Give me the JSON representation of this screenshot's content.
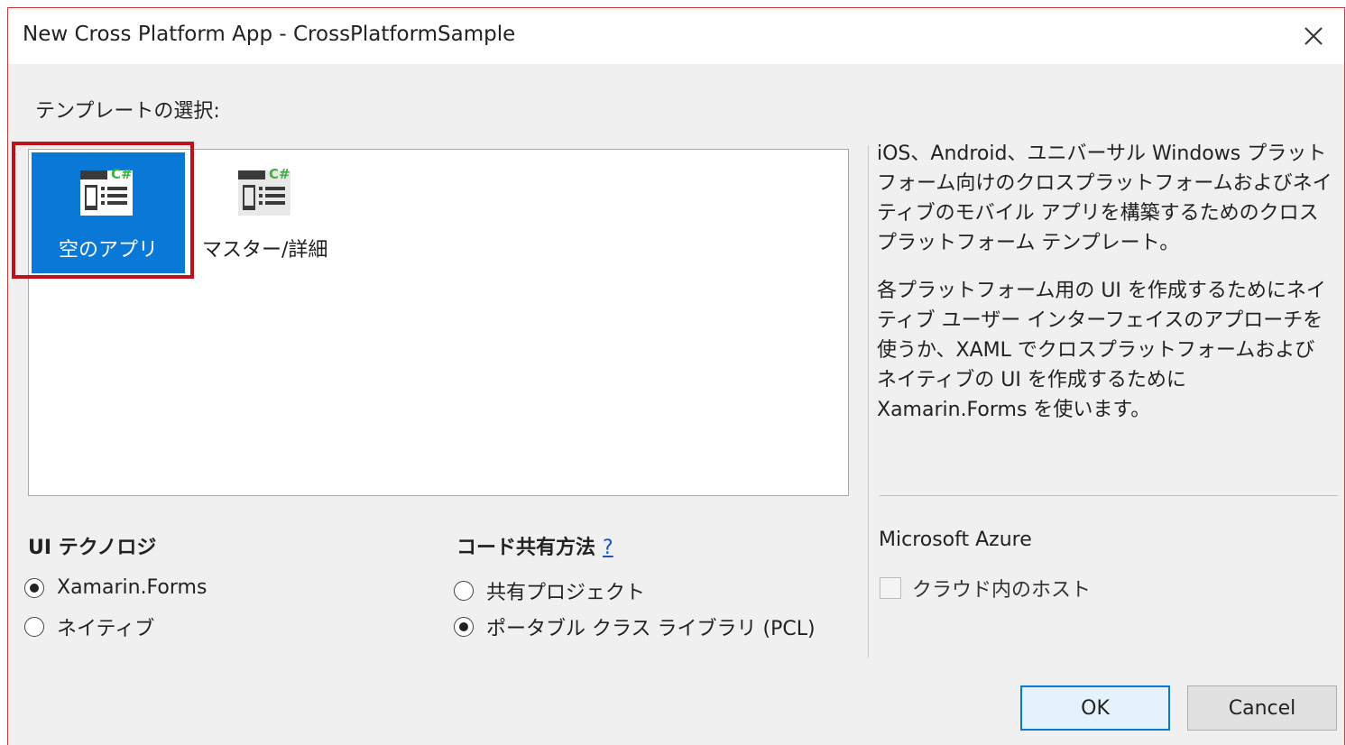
{
  "window": {
    "title": "New Cross Platform App - CrossPlatformSample"
  },
  "templates": {
    "label": "テンプレートの選択:",
    "items": [
      {
        "name": "空のアプリ",
        "selected": true,
        "icon": "blank-app-csharp-icon"
      },
      {
        "name": "マスター/詳細",
        "selected": false,
        "icon": "master-detail-csharp-icon"
      }
    ]
  },
  "description": {
    "p1": "iOS、Android、ユニバーサル Windows プラットフォーム向けのクロスプラットフォームおよびネイティブのモバイル アプリを構築するためのクロスプラットフォーム テンプレート。",
    "p2": "各プラットフォーム用の UI を作成するためにネイティブ ユーザー インターフェイスのアプローチを使うか、XAML でクロスプラットフォームおよびネイティブの UI を作成するために Xamarin.Forms を使います。"
  },
  "ui_technology": {
    "heading": "UI テクノロジ",
    "options": [
      {
        "label": "Xamarin.Forms",
        "checked": true
      },
      {
        "label": "ネイティブ",
        "checked": false
      }
    ]
  },
  "code_sharing": {
    "heading": "コード共有方法",
    "help": "?",
    "options": [
      {
        "label": "共有プロジェクト",
        "checked": false
      },
      {
        "label": "ポータブル クラス ライブラリ (PCL)",
        "checked": true
      }
    ]
  },
  "azure": {
    "heading": "Microsoft Azure",
    "host_label": "クラウド内のホスト",
    "host_checked": false
  },
  "buttons": {
    "ok": "OK",
    "cancel": "Cancel"
  },
  "colors": {
    "selection": "#0a78d7",
    "highlight_border": "#c0101a",
    "link": "#1a52c9",
    "csharp_badge": "#3fb043"
  }
}
